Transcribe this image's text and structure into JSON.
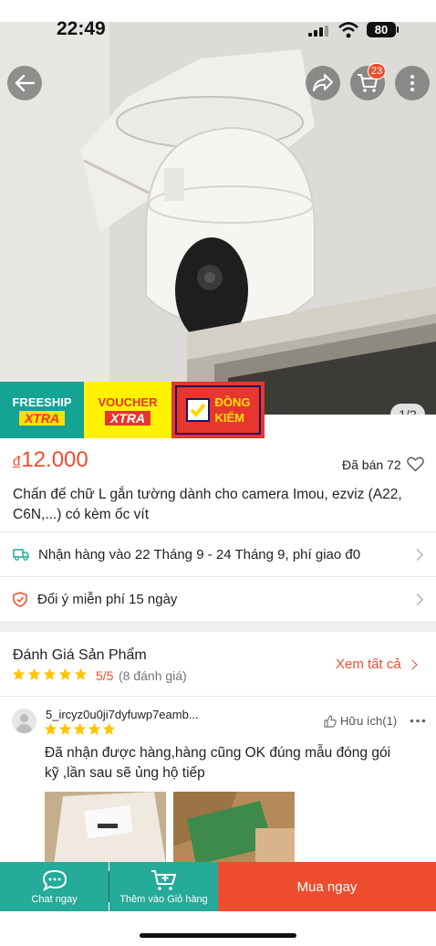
{
  "status_bar": {
    "time": "22:49",
    "battery": "80"
  },
  "header": {
    "cart_count": "23",
    "image_counter": "1/2"
  },
  "badges": {
    "freeship": "FREESHIP",
    "freeship_sub": "XTRA",
    "voucher": "VOUCHER",
    "voucher_sub": "XTRA",
    "dongkiem_1": "ĐỒNG",
    "dongkiem_2": "KIỂM"
  },
  "product": {
    "currency": "đ",
    "price": "12.000",
    "sold": "Đã bán 72",
    "title": "Chấn đế chữ L gắn tường dành cho camera Imou, ezviz (A22, C6N,...) có kèm ốc vít"
  },
  "shipping": {
    "text": "Nhận hàng vào 22 Tháng 9 - 24 Tháng 9, phí giao đ0"
  },
  "return_policy": {
    "text": "Đổi ý miễn phí 15 ngày"
  },
  "reviews": {
    "heading": "Đánh Giá Sản Phẩm",
    "rating": "5/5",
    "count": "(8 đánh giá)",
    "see_all": "Xem tất cả",
    "stars": 5,
    "items": [
      {
        "user": "5_ircyz0u0ji7dyfuwp7eamb...",
        "helpful": "Hữu ích(1)",
        "stars": 5,
        "text_line1": "Đã nhận được hàng,hàng cũng OK đúng mẫu đóng gói",
        "text_line2": "kỹ ,lần sau sẽ ủng hộ tiếp"
      }
    ]
  },
  "bottom_bar": {
    "chat": "Chat ngay",
    "add_cart": "Thêm vào Giỏ hàng",
    "buy": "Mua ngay"
  },
  "colors": {
    "accent": "#ee4d2d",
    "teal": "#26aa99",
    "star": "#ffc400",
    "yellow": "#fff200"
  }
}
